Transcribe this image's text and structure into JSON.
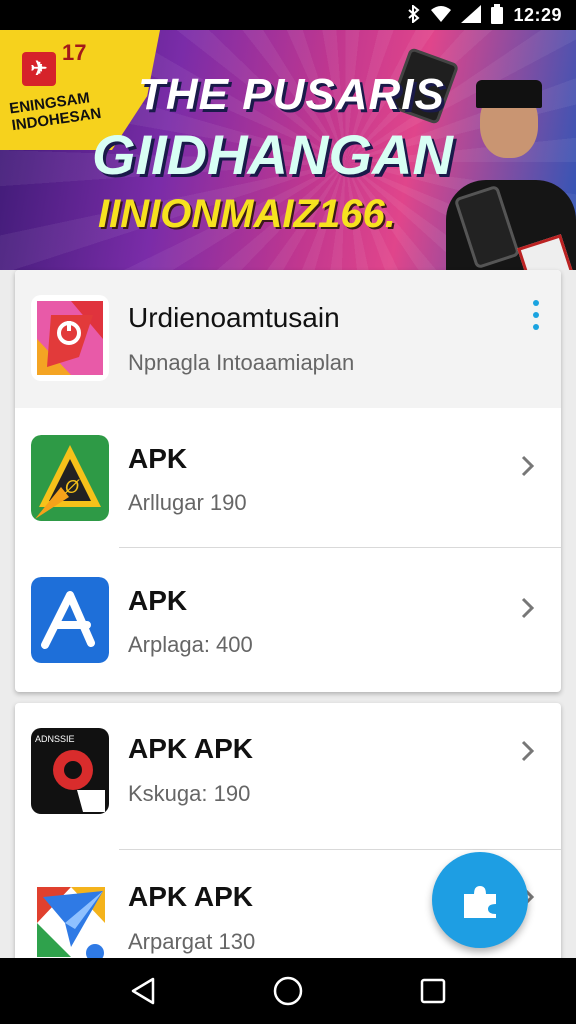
{
  "status_bar": {
    "time": "12:29",
    "icons": [
      "bluetooth-icon",
      "wifi-icon",
      "signal-icon",
      "battery-icon"
    ]
  },
  "banner": {
    "flag_badge": "17",
    "flag_text": "ENINGSAM INDOHESAN",
    "headline_1": "THE PUSARIS",
    "headline_2": "GIIDHANGAN",
    "headline_3": "IINIONMAIZ166.",
    "colors": {
      "flag": "#f6d21d",
      "headline_accent": "#f7e21f"
    }
  },
  "list_1": {
    "header": {
      "title": "Urdienoamtusain",
      "subtitle": "Npnagla Intoaamiaplan",
      "icon": "brand-app-icon"
    },
    "items": [
      {
        "title": "APK",
        "subtitle": "Arllugar 190",
        "icon": "triangle-app-icon"
      },
      {
        "title": "APK",
        "subtitle": "Arplaga: 400",
        "icon": "blue-a-app-icon"
      }
    ]
  },
  "list_2": {
    "items": [
      {
        "title": "APK APK",
        "subtitle": "Kskuga: 190",
        "icon": "red-circle-app-icon",
        "icon_label": "ADNSSIE"
      },
      {
        "title": "APK APK",
        "subtitle": "Arpargat 130",
        "icon": "paper-plane-app-icon"
      }
    ]
  },
  "fab": {
    "icon": "puzzle-icon",
    "color": "#1e9ee3"
  },
  "nav_bar": {
    "buttons": [
      "back-icon",
      "home-icon",
      "recents-icon"
    ]
  }
}
